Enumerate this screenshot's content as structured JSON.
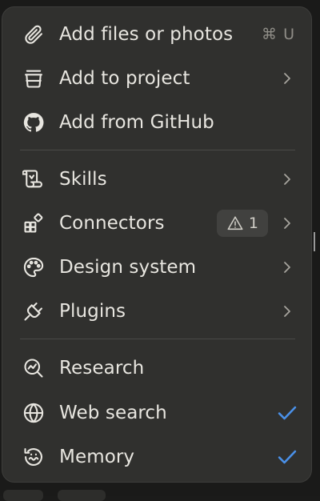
{
  "menu": {
    "group1": [
      {
        "label": "Add files or photos",
        "icon": "paperclip-icon",
        "shortcut": "⌘ U"
      },
      {
        "label": "Add to project",
        "icon": "project-box-icon",
        "has_submenu": true
      },
      {
        "label": "Add from GitHub",
        "icon": "github-icon"
      }
    ],
    "group2": [
      {
        "label": "Skills",
        "icon": "scroll-icon",
        "has_submenu": true
      },
      {
        "label": "Connectors",
        "icon": "connectors-grid-icon",
        "has_submenu": true,
        "badge": {
          "icon": "warning-icon",
          "count": "1"
        }
      },
      {
        "label": "Design system",
        "icon": "palette-icon",
        "has_submenu": true
      },
      {
        "label": "Plugins",
        "icon": "plug-icon",
        "has_submenu": true
      }
    ],
    "group3": [
      {
        "label": "Research",
        "icon": "research-icon"
      },
      {
        "label": "Web search",
        "icon": "globe-icon",
        "checked": true
      },
      {
        "label": "Memory",
        "icon": "memory-icon",
        "checked": true
      }
    ]
  },
  "colors": {
    "menu_background": "#30302e",
    "text": "#e8e6e0",
    "check_accent": "#4a90e8",
    "badge_background": "#41413f"
  }
}
